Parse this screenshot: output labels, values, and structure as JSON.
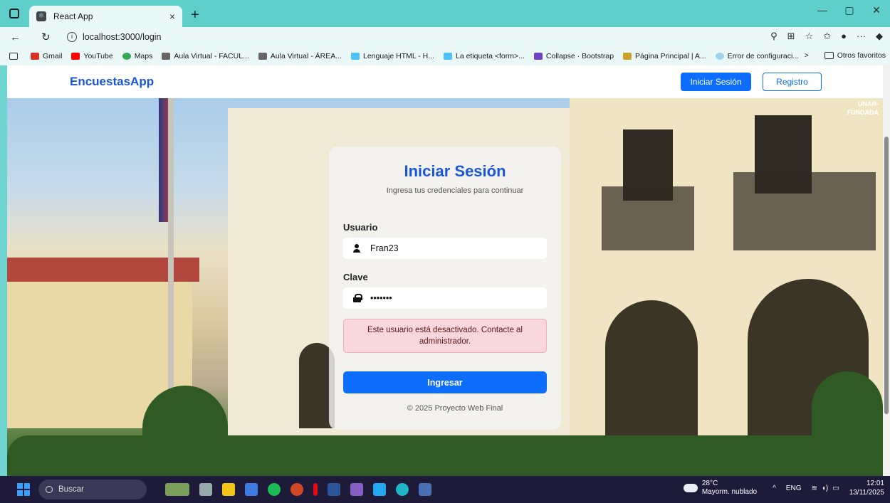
{
  "browser": {
    "tab_title": "React App",
    "url": "localhost:3000/login",
    "bookmarks": [
      "Gmail",
      "YouTube",
      "Maps",
      "Aula Virtual - FACUL...",
      "Aula Virtual - ÁREA...",
      "Lenguaje HTML - H...",
      "La etiqueta <form>...",
      "Collapse · Bootstrap",
      "Página Principal | A...",
      "Error de configuraci..."
    ],
    "other_favorites": "Otros favoritos"
  },
  "navbar": {
    "brand": "EncuestasApp",
    "login_button": "Iniciar Sesión",
    "register_button": "Registro"
  },
  "corner_text": [
    "UNAR-",
    "FUNDADA"
  ],
  "login": {
    "title": "Iniciar Sesión",
    "subtitle": "Ingresa tus credenciales para continuar",
    "user_label": "Usuario",
    "user_value": "Fran23",
    "password_label": "Clave",
    "password_value": "•••••••",
    "error": "Este usuario está desactivado. Contacte al administrador.",
    "submit": "Ingresar",
    "footer": "© 2025 Proyecto Web Final"
  },
  "taskbar": {
    "search": "Buscar",
    "temperature": "28°C",
    "weather": "Mayorm. nublado",
    "language": "ENG",
    "time": "12:01",
    "date": "13/11/2025"
  },
  "colors": {
    "primary": "#0d6efd",
    "brand": "#1a56d9",
    "alert_bg": "#f8d7da",
    "browser_frame": "#5fcfcb"
  }
}
